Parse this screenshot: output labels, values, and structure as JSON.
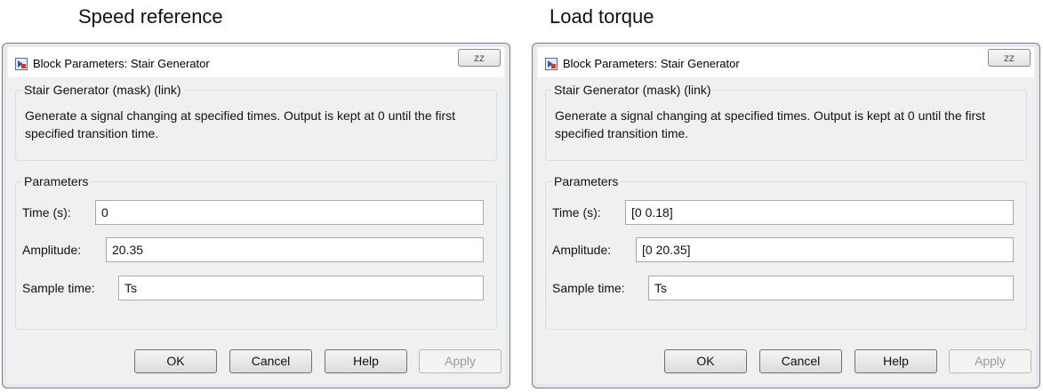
{
  "captions": {
    "left": "Speed reference",
    "right": "Load torque"
  },
  "dialogs": [
    {
      "title": "Block Parameters: Stair Generator",
      "close_glyph": "ᴢᴢ",
      "mask_group_title": "Stair Generator (mask) (link)",
      "description": "Generate a signal changing at specified times. Output is kept at 0 until the first specified transition time.",
      "params_group_title": "Parameters",
      "params": {
        "time_label": "Time (s):",
        "time_value": "0",
        "amplitude_label": "Amplitude:",
        "amplitude_value": "20.35",
        "sample_label": "Sample time:",
        "sample_value": "Ts"
      },
      "buttons": {
        "ok": "OK",
        "cancel": "Cancel",
        "help": "Help",
        "apply": "Apply"
      }
    },
    {
      "title": "Block Parameters: Stair Generator",
      "close_glyph": "ᴢᴢ",
      "mask_group_title": "Stair Generator (mask) (link)",
      "description": "Generate a signal changing at specified times. Output is kept at 0 until the first specified transition time.",
      "params_group_title": "Parameters",
      "params": {
        "time_label": "Time (s):",
        "time_value": "[0 0.18]",
        "amplitude_label": "Amplitude:",
        "amplitude_value": "[0 20.35]",
        "sample_label": "Sample time:",
        "sample_value": "Ts"
      },
      "buttons": {
        "ok": "OK",
        "cancel": "Cancel",
        "help": "Help",
        "apply": "Apply"
      }
    }
  ]
}
